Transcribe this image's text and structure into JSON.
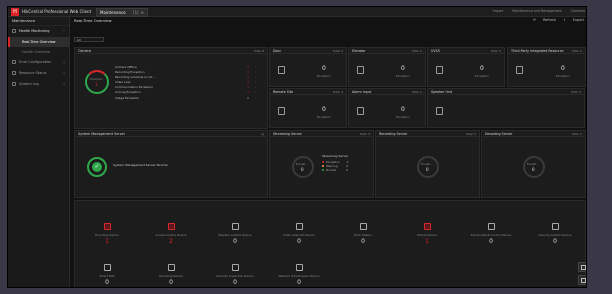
{
  "window": {
    "app_title": "HikCentral Professional Web Client",
    "tab_label": "Maintenance",
    "tab_count": "(1)"
  },
  "top_links": [
    "Import",
    "Maintenance and Management",
    "Cameras"
  ],
  "sidebar": {
    "header": "Maintenance",
    "items": [
      {
        "label": "Health Monitoring",
        "open": true
      },
      {
        "label": "Real-Time Overview",
        "sub": true,
        "active": true
      },
      {
        "label": "Health Overview",
        "sub": true,
        "dim": true
      },
      {
        "label": "Error Configuration"
      },
      {
        "label": "Resource Status"
      },
      {
        "label": "System Log"
      }
    ]
  },
  "main": {
    "title": "Real-Time Overview",
    "refresh": "Refresh",
    "export": "Export",
    "select_value": "All"
  },
  "camera": {
    "title": "Camera",
    "total": "Total: 8",
    "donut_label": "Exception",
    "donut_value": "1",
    "rows": [
      {
        "label": "Camera Offline",
        "value": "1"
      },
      {
        "label": "Recording Exception",
        "value": "1"
      },
      {
        "label": "Recording schedule is not ...",
        "value": "1"
      },
      {
        "label": "Video Loss",
        "value": "1"
      },
      {
        "label": "Communication Exception",
        "value": "1"
      },
      {
        "label": "Arming Exception",
        "value": "1"
      },
      {
        "label": "Image Exception",
        "value": "0"
      }
    ]
  },
  "small_cards": [
    {
      "title": "Door",
      "total": "Total: 0",
      "value": "0",
      "sub": "Exception",
      "icon": "door-icon"
    },
    {
      "title": "Elevator",
      "total": "Total: 0",
      "value": "0",
      "sub": "Exception",
      "icon": "elevator-icon"
    },
    {
      "title": "UVSS",
      "total": "Total: 0",
      "value": "0",
      "sub": "Exception",
      "icon": "uvss-icon"
    },
    {
      "title": "Third-Party Integrated Resource",
      "total": "Total: 0",
      "value": "0",
      "sub": "Exception",
      "icon": "integrated-resource-icon"
    },
    {
      "title": "Remote Site",
      "total": "Total: 0",
      "value": "0",
      "sub": "Exception",
      "icon": "remote-site-icon"
    },
    {
      "title": "Alarm Input",
      "total": "Total: 0",
      "value": "0",
      "sub": "Exception",
      "icon": "alarm-input-icon"
    },
    {
      "title": "Speaker Unit",
      "total": "Total: 0",
      "value": "0",
      "sub": "Exception",
      "icon": "speaker-icon"
    }
  ],
  "system_mgmt": {
    "title": "System Management Server",
    "status": "System Management Server Normal",
    "status_color": "#2ea84b"
  },
  "streaming": {
    "title": "Streaming Server",
    "total": "Total: 0",
    "donut_label": "Excepti...",
    "donut_value": "0",
    "legend_title": "Streaming Server",
    "legend": [
      {
        "label": "Exception",
        "value": "0",
        "color": "#d9262b"
      },
      {
        "label": "Warning",
        "value": "0",
        "color": "#e8a33d"
      },
      {
        "label": "Normal",
        "value": "0",
        "color": "#2ea84b"
      }
    ]
  },
  "recording": {
    "title": "Recording Server",
    "total": "Total: 0",
    "donut_label": "Excepti...",
    "donut_value": "0"
  },
  "decoder": {
    "title": "Decoding Server",
    "total": "Total: 0",
    "donut_label": "Excepti...",
    "donut_value": "0"
  },
  "devices": [
    {
      "name": "Encoding Device",
      "value": "1",
      "alert": true,
      "icon": "encoding-device-icon"
    },
    {
      "name": "Access Control Device",
      "value": "2",
      "alert": true,
      "icon": "access-control-icon"
    },
    {
      "name": "Elevator Control Device",
      "value": "0",
      "icon": "elevator-control-icon"
    },
    {
      "name": "Video Intercom Device",
      "value": "0",
      "icon": "video-intercom-icon"
    },
    {
      "name": "Dock Station",
      "value": "0",
      "icon": "dock-station-icon"
    },
    {
      "name": "Mobile Device",
      "value": "1",
      "alert": true,
      "icon": "mobile-device-icon"
    },
    {
      "name": "Entrance/Exit Control Device",
      "value": "0",
      "icon": "entrance-exit-icon"
    },
    {
      "name": "Security Control Device",
      "value": "0",
      "icon": "security-control-icon"
    },
    {
      "name": "Smart Wall",
      "value": "0",
      "icon": "smart-wall-icon"
    },
    {
      "name": "Decoding Device",
      "value": "0",
      "icon": "decoding-device-icon"
    },
    {
      "name": "Security Inspection Device",
      "value": "0",
      "icon": "security-inspection-icon"
    },
    {
      "name": "Network Transmission Device",
      "value": "0",
      "icon": "network-transmission-icon"
    }
  ],
  "colors": {
    "accent": "#d9262b",
    "ok": "#2ea84b",
    "warn": "#e8a33d"
  }
}
